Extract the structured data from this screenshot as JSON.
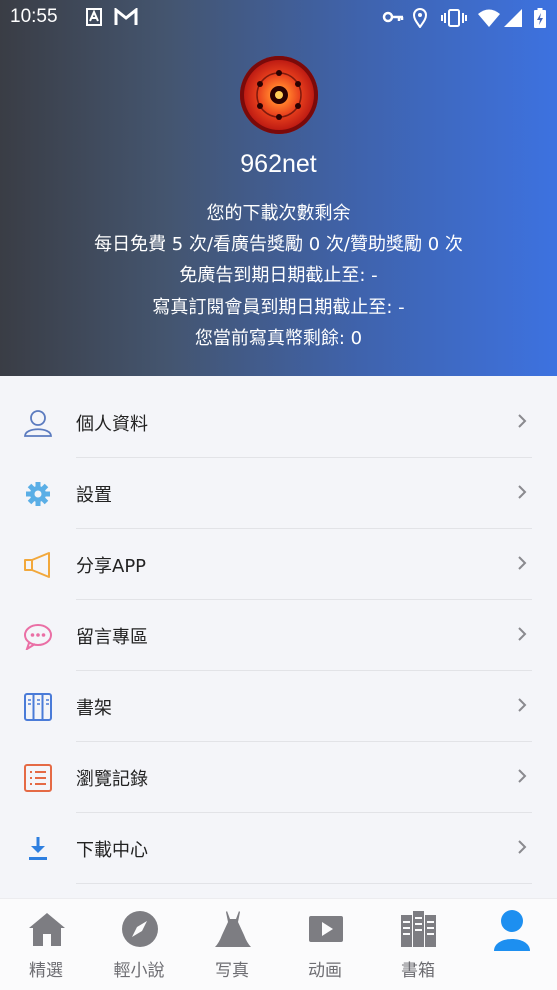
{
  "status_bar": {
    "time": "10:55",
    "icons": [
      "a-keyboard-icon",
      "gmail-icon",
      "key-icon",
      "location-icon",
      "vibrate-icon",
      "wifi-icon",
      "signal-icon",
      "battery-icon"
    ]
  },
  "profile": {
    "username": "962net",
    "lines": [
      "您的下載次數剩余",
      "每日免費 5 次/看廣告獎勵 0 次/贊助獎勵 0 次",
      "免廣告到期日期截止至: -",
      "寫真訂閱會員到期日期截止至: -",
      "您當前寫真幣剩餘: 0"
    ]
  },
  "menu": {
    "items": [
      {
        "label": "個人資料",
        "icon": "user-icon",
        "color": "#5b7bbf"
      },
      {
        "label": "設置",
        "icon": "gear-icon",
        "color": "#5aaee6"
      },
      {
        "label": "分享APP",
        "icon": "megaphone-icon",
        "color": "#f2a83c"
      },
      {
        "label": "留言專區",
        "icon": "chat-bubble-icon",
        "color": "#ea6fa5"
      },
      {
        "label": "書架",
        "icon": "bookshelf-icon",
        "color": "#4a7bd8"
      },
      {
        "label": "瀏覽記錄",
        "icon": "history-list-icon",
        "color": "#e56a45"
      },
      {
        "label": "下載中心",
        "icon": "download-icon",
        "color": "#2e7fe0"
      }
    ]
  },
  "tabs": [
    {
      "label": "精選",
      "icon": "home-icon"
    },
    {
      "label": "輕小說",
      "icon": "compass-icon"
    },
    {
      "label": "写真",
      "icon": "dress-icon"
    },
    {
      "label": "动画",
      "icon": "play-icon"
    },
    {
      "label": "書箱",
      "icon": "books-icon"
    },
    {
      "label": "",
      "icon": "profile-icon",
      "active": true
    }
  ],
  "colors": {
    "accent": "#1d8ff0",
    "tab_inactive": "#6d6d72",
    "background": "#f4f5f9"
  }
}
